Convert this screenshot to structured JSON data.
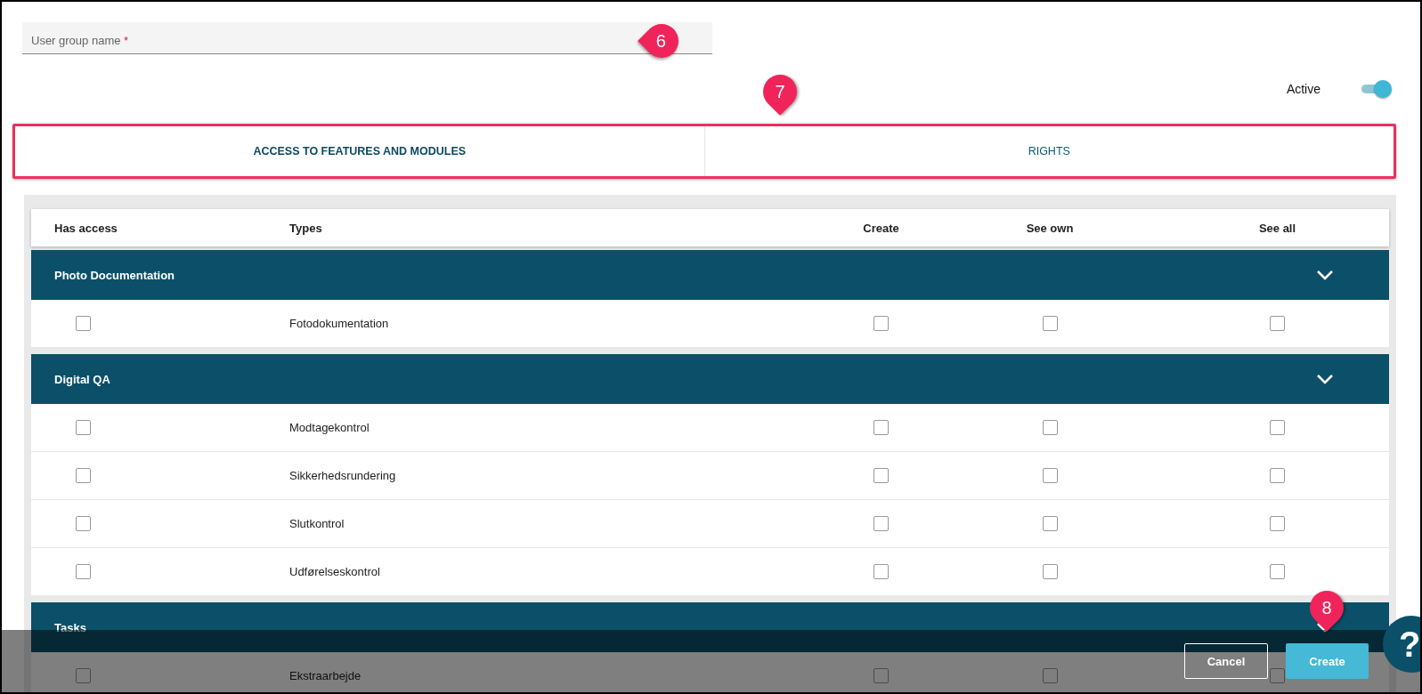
{
  "field": {
    "label": "User group name",
    "required_mark": "*"
  },
  "active": {
    "label": "Active",
    "on": true
  },
  "tabs": [
    {
      "label": "ACCESS TO FEATURES AND MODULES",
      "selected": true
    },
    {
      "label": "RIGHTS",
      "selected": false
    }
  ],
  "table": {
    "columns": [
      "Has access",
      "Types",
      "Create",
      "See own",
      "See all"
    ],
    "groups": [
      {
        "name": "Photo Documentation",
        "expanded": true,
        "rows": [
          {
            "type": "Fotodokumentation",
            "has_access": false,
            "create": false,
            "see_own": false,
            "see_all": false
          }
        ]
      },
      {
        "name": "Digital QA",
        "expanded": true,
        "rows": [
          {
            "type": "Modtagekontrol",
            "has_access": false,
            "create": false,
            "see_own": false,
            "see_all": false
          },
          {
            "type": "Sikkerhedsrundering",
            "has_access": false,
            "create": false,
            "see_own": false,
            "see_all": false
          },
          {
            "type": "Slutkontrol",
            "has_access": false,
            "create": false,
            "see_own": false,
            "see_all": false
          },
          {
            "type": "Udførelseskontrol",
            "has_access": false,
            "create": false,
            "see_own": false,
            "see_all": false
          }
        ]
      },
      {
        "name": "Tasks",
        "expanded": true,
        "rows": [
          {
            "type": "Ekstraarbejde",
            "has_access": false,
            "create": false,
            "see_own": false,
            "see_all": false
          }
        ]
      }
    ]
  },
  "buttons": {
    "cancel": "Cancel",
    "create": "Create"
  },
  "help": "?",
  "callouts": [
    "6",
    "7",
    "8"
  ]
}
